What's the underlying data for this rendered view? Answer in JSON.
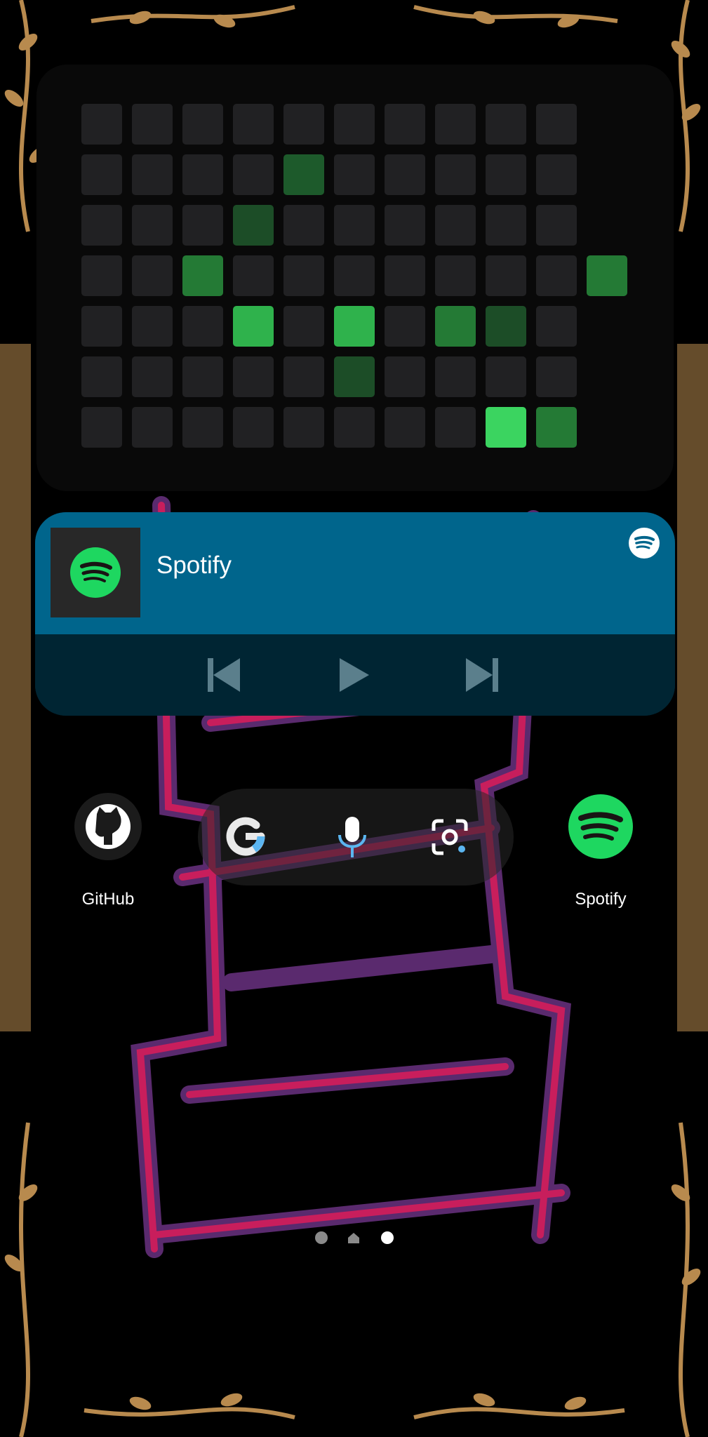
{
  "contribution_widget": {
    "levels": [
      [
        0,
        0,
        0,
        0,
        0,
        0,
        0,
        0,
        0,
        0,
        -1
      ],
      [
        0,
        0,
        0,
        0,
        2,
        0,
        0,
        0,
        0,
        0,
        -1
      ],
      [
        0,
        0,
        0,
        1,
        0,
        0,
        0,
        0,
        0,
        0,
        -1
      ],
      [
        0,
        0,
        3,
        0,
        0,
        0,
        0,
        0,
        0,
        0,
        3
      ],
      [
        0,
        0,
        0,
        4,
        0,
        4,
        0,
        3,
        1,
        0,
        -1
      ],
      [
        0,
        0,
        0,
        0,
        0,
        1,
        0,
        0,
        0,
        0,
        -1
      ],
      [
        0,
        0,
        0,
        0,
        0,
        0,
        0,
        0,
        5,
        3,
        -1
      ]
    ],
    "colors": {
      "0": "#212123",
      "1": "#1c4d27",
      "2": "#1d5a2b",
      "3": "#247a35",
      "4": "#2fb24c",
      "5": "#3bd460"
    }
  },
  "media_player": {
    "app_name": "Spotify",
    "controls": [
      "previous",
      "play",
      "next"
    ]
  },
  "home_apps": {
    "github_label": "GitHub",
    "spotify_label": "Spotify"
  },
  "search_bar": {
    "icons": [
      "google-g-icon",
      "microphone-icon",
      "lens-camera-icon"
    ]
  },
  "page_indicator": {
    "pages": 3,
    "current": 2
  }
}
